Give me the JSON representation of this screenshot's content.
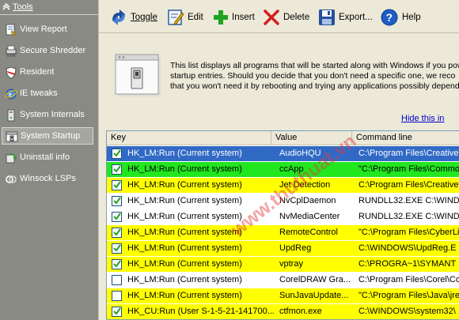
{
  "sidebar": {
    "header": "Tools",
    "items": [
      {
        "label": "View Report",
        "icon": "view-report-icon"
      },
      {
        "label": "Secure Shredder",
        "icon": "shredder-icon"
      },
      {
        "label": "Resident",
        "icon": "shield-icon"
      },
      {
        "label": "IE tweaks",
        "icon": "internet-explorer-icon"
      },
      {
        "label": "System Internals",
        "icon": "system-internals-icon"
      },
      {
        "label": "System Startup",
        "icon": "system-startup-icon",
        "active": true
      },
      {
        "label": "Uninstall info",
        "icon": "uninstall-icon"
      },
      {
        "label": "Winsock LSPs",
        "icon": "winsock-icon"
      }
    ]
  },
  "toolbar": {
    "toggle": "Toggle",
    "edit": "Edit",
    "insert": "Insert",
    "delete": "Delete",
    "export": "Export...",
    "help": "Help"
  },
  "info": {
    "line1": "This list displays all programs that will be started along with Windows if you pow",
    "line2": "startup entries. Should you decide that you don't need a specific one, we reco",
    "line3": "that you won't need it by rebooting and trying any applications possibly depend",
    "hide_link": "Hide this in"
  },
  "table": {
    "headers": {
      "key": "Key",
      "value": "Value",
      "command": "Command line"
    },
    "rows": [
      {
        "checked": true,
        "key": "HK_LM:Run (Current system)",
        "value": "AudioHQU",
        "command": "C:\\Program Files\\Creative\\",
        "color": "#316ac5"
      },
      {
        "checked": true,
        "key": "HK_LM:Run (Current system)",
        "value": "ccApp",
        "command": "\"C:\\Program Files\\Commo",
        "color": "#22e61e"
      },
      {
        "checked": true,
        "key": "HK_LM:Run (Current system)",
        "value": "Jet Detection",
        "command": "C:\\Program Files\\Creative",
        "color": "#ffff00"
      },
      {
        "checked": true,
        "key": "HK_LM:Run (Current system)",
        "value": "NvCplDaemon",
        "command": "RUNDLL32.EXE C:\\WIND",
        "color": "#ffffff"
      },
      {
        "checked": true,
        "key": "HK_LM:Run (Current system)",
        "value": "NvMediaCenter",
        "command": "RUNDLL32.EXE C:\\WIND",
        "color": "#ffffff"
      },
      {
        "checked": true,
        "key": "HK_LM:Run (Current system)",
        "value": "RemoteControl",
        "command": "\"C:\\Program Files\\CyberLi",
        "color": "#ffff00"
      },
      {
        "checked": true,
        "key": "HK_LM:Run (Current system)",
        "value": "UpdReg",
        "command": "C:\\WINDOWS\\UpdReg.E",
        "color": "#ffff00"
      },
      {
        "checked": true,
        "key": "HK_LM:Run (Current system)",
        "value": "vptray",
        "command": "C:\\PROGRA~1\\SYMANT",
        "color": "#ffff00"
      },
      {
        "checked": false,
        "key": "HK_LM:Run (Current system)",
        "value": "CorelDRAW Gra...",
        "command": "C:\\Program Files\\Corel\\Co",
        "color": "#ffffff"
      },
      {
        "checked": false,
        "key": "HK_LM:Run (Current system)",
        "value": "SunJavaUpdate...",
        "command": "\"C:\\Program Files\\Java\\jre",
        "color": "#ffff00"
      },
      {
        "checked": true,
        "key": "HK_CU:Run (User S-1-5-21-141700...",
        "value": "ctfmon.exe",
        "command": "C:\\WINDOWS\\system32\\",
        "color": "#ffff00"
      }
    ]
  },
  "watermark": "www.thuthuat.vn",
  "colors": {
    "sidebar_bg": "#8a8a84",
    "selected_row": "#316ac5",
    "checkbox_border": "#1c5180",
    "tick": "#21a121"
  }
}
